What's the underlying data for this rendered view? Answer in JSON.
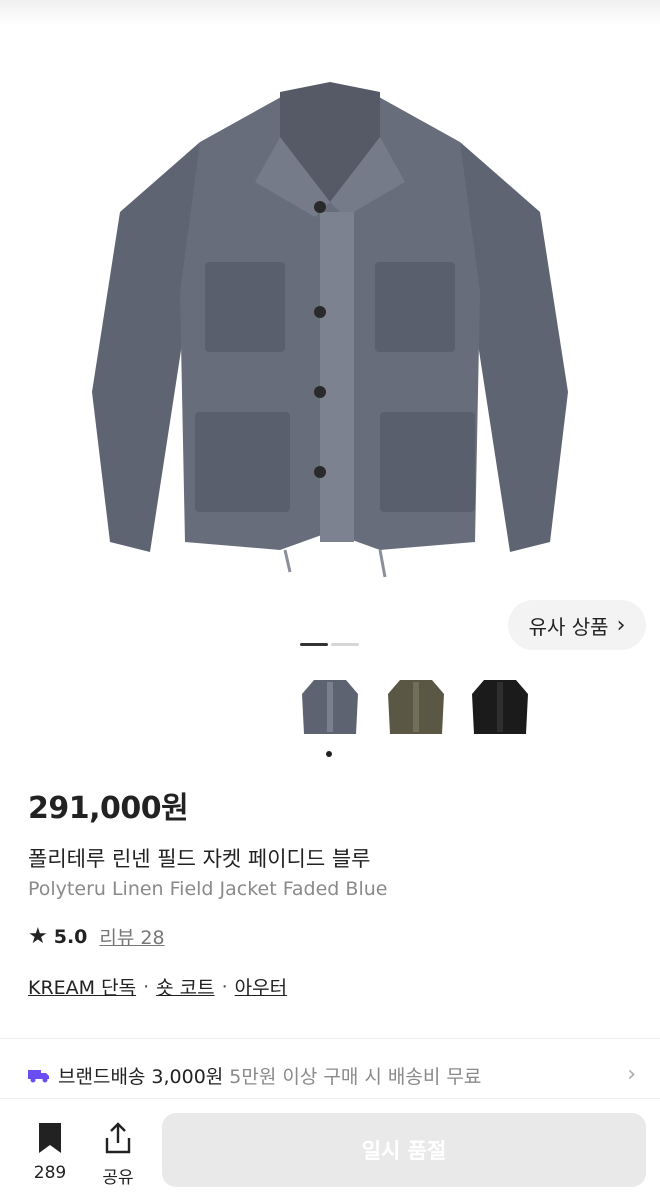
{
  "hero": {
    "similar_label": "유사 상품"
  },
  "product": {
    "price": "291,000원",
    "name_ko": "폴리테루 린넨 필드 자켓 페이디드 블루",
    "name_en": "Polyteru Linen Field Jacket Faded Blue",
    "rating": "5.0",
    "reviews": "리뷰 28",
    "tags": [
      "KREAM 단독",
      "숏 코트",
      "아우터"
    ],
    "swatch_colors": [
      "#5d6370",
      "#5a5844",
      "#1b1b1b"
    ]
  },
  "shipping": {
    "label": "브랜드배송",
    "price": "3,000원",
    "note": "5만원 이상 구매 시 배송비 무료"
  },
  "bottom": {
    "bookmark_count": "289",
    "share_label": "공유",
    "action_label": "일시 품절"
  },
  "icons": [
    "truck-icon",
    "bookmark-icon",
    "share-icon",
    "star-icon",
    "chevron-right-icon"
  ]
}
